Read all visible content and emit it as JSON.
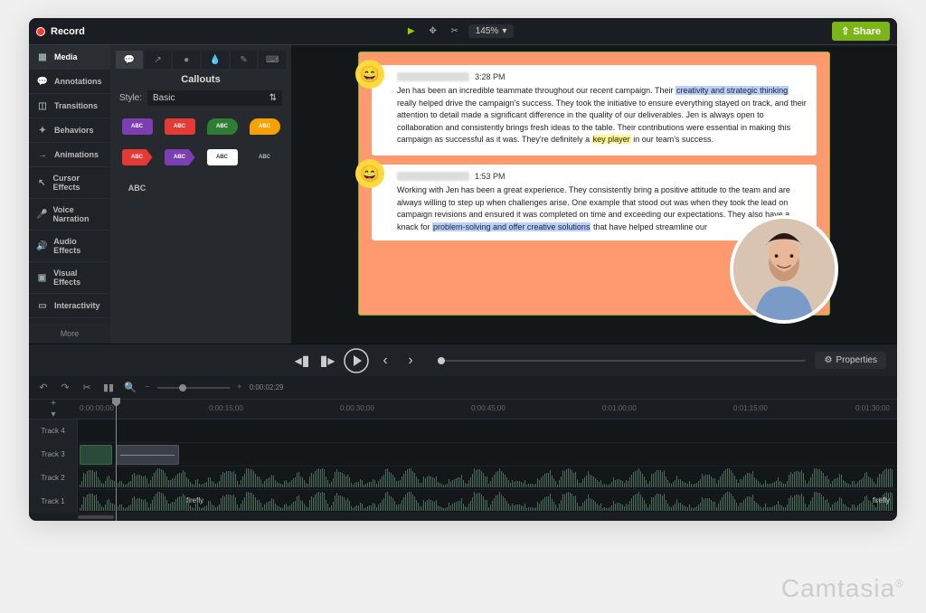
{
  "top": {
    "record": "Record",
    "zoom": "145%",
    "share": "Share"
  },
  "sidebar": {
    "items": [
      {
        "label": "Media"
      },
      {
        "label": "Annotations"
      },
      {
        "label": "Transitions"
      },
      {
        "label": "Behaviors"
      },
      {
        "label": "Animations"
      },
      {
        "label": "Cursor Effects"
      },
      {
        "label": "Voice Narration"
      },
      {
        "label": "Audio Effects"
      },
      {
        "label": "Visual Effects"
      },
      {
        "label": "Interactivity"
      }
    ],
    "more": "More"
  },
  "panel": {
    "title": "Callouts",
    "style_label": "Style:",
    "style_value": "Basic",
    "abc": "ABC"
  },
  "playback": {
    "properties": "Properties"
  },
  "timeline": {
    "timecode": "0:00:02;29",
    "ruler": [
      "0:00:00;00",
      "0:00:15;00",
      "0:00:30;00",
      "0:00:45;00",
      "0:01:00;00",
      "0:01:15;00",
      "0:01:30;00"
    ],
    "tracks": [
      "Track 4",
      "Track 3",
      "Track 2",
      "Track 1"
    ],
    "clip1_label": "firefly",
    "clip1_label_right": "firefly"
  },
  "canvas": {
    "comment1": {
      "time": "3:28 PM",
      "text_a": "Jen has been an incredible teammate throughout our recent campaign. Their ",
      "hl1": "creativity and strategic thinking",
      "text_b": " really helped drive the campaign's success. They took the initiative to ensure everything stayed on track, and their attention to detail made a significant difference in the quality of our deliverables. Jen is always open to collaboration and consistently brings fresh ideas to the table. Their contributions were essential in making this campaign as successful as it was. They're definitely a ",
      "hl2": "key player",
      "text_c": " in our team's success."
    },
    "comment2": {
      "time": "1:53 PM",
      "text_a": "Working with Jen has been a great experience. They consistently bring a positive attitude to the team and are always willing to step up when challenges arise. One example that stood out was when they took the lead on campaign revisions and ensured it was completed on time and exceeding our expectations. They also have a knack for ",
      "hl1": "problem-solving and offer creative solutions",
      "text_b": " that have helped streamline our"
    }
  },
  "watermark": "Camtasia"
}
